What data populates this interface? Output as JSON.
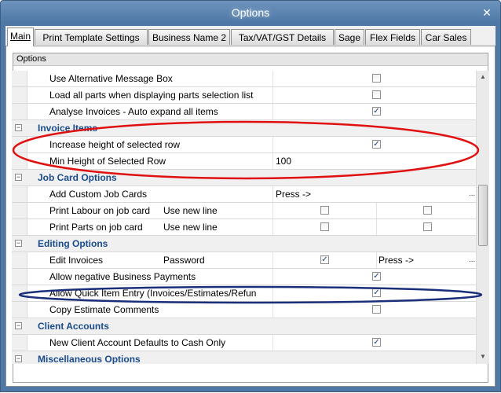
{
  "window": {
    "title": "Options",
    "close_glyph": "✕"
  },
  "tabs": [
    {
      "label": "Main",
      "active": true
    },
    {
      "label": "Print Template Settings"
    },
    {
      "label": "Business Name 2"
    },
    {
      "label": "Tax/VAT/GST Details"
    },
    {
      "label": "Sage"
    },
    {
      "label": "Flex Fields"
    },
    {
      "label": "Car Sales"
    }
  ],
  "group": {
    "label": "Options"
  },
  "rows": {
    "r0": {
      "label": "Use Alternative Message Box",
      "checked": false
    },
    "r1": {
      "label": "Load all parts when displaying parts selection list",
      "checked": false
    },
    "r2": {
      "label": "Analyse Invoices - Auto expand all items",
      "checked": true
    },
    "cat_invoice": {
      "label": "Invoice Items"
    },
    "r3": {
      "label": "Increase height of selected row",
      "checked": true
    },
    "r4": {
      "label": "Min Height of Selected Row",
      "value": "100"
    },
    "cat_job": {
      "label": "Job Card Options"
    },
    "r5": {
      "label": "Add Custom Job Cards",
      "value": "Press ->",
      "button": "..."
    },
    "r6": {
      "label": "Print Labour on job card",
      "sub": "Use new line",
      "check1": false,
      "check2": false
    },
    "r7": {
      "label": "Print Parts on job card",
      "sub": "Use new line",
      "check1": false,
      "check2": false
    },
    "cat_edit": {
      "label": "Editing Options"
    },
    "r8": {
      "label": "Edit Invoices",
      "sub": "Password",
      "checked": true,
      "value": "Press ->",
      "button": "..."
    },
    "r9": {
      "label": "Allow negative Business Payments",
      "checked": true
    },
    "r10": {
      "label": "Allow Quick Item Entry (Invoices/Estimates/Refun",
      "checked": true
    },
    "r11": {
      "label": "Copy Estimate Comments",
      "checked": false
    },
    "cat_client": {
      "label": "Client Accounts"
    },
    "r12": {
      "label": "New Client Account Defaults to Cash Only",
      "checked": true
    },
    "cat_misc": {
      "label": "Miscellaneous Options"
    }
  },
  "colors": {
    "title_bar": "#5580ae",
    "category_text": "#1a4c8b",
    "red_annotation": "#e01010",
    "blue_annotation": "#1a2f7a"
  }
}
